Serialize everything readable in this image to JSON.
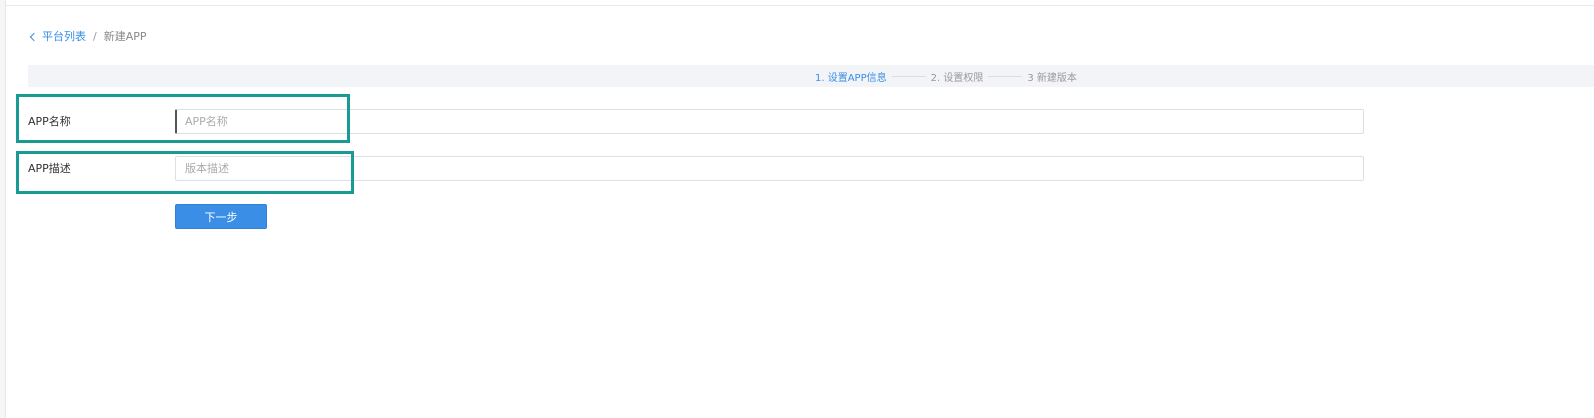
{
  "breadcrumb": {
    "back_label": "平台列表",
    "separator": "/",
    "current": "新建APP"
  },
  "steps": [
    {
      "label": "1. 设置APP信息",
      "active": true
    },
    {
      "label": "2. 设置权限",
      "active": false
    },
    {
      "label": "3 新建版本",
      "active": false
    }
  ],
  "form": {
    "app_name": {
      "label": "APP名称",
      "value": "",
      "placeholder": "APP名称"
    },
    "app_description": {
      "label": "APP描述",
      "value": "",
      "placeholder": "版本描述"
    }
  },
  "actions": {
    "next_label": "下一步"
  },
  "colors": {
    "accent": "#3a8ee6",
    "highlight_box": "#1a9a94",
    "steps_bar_background": "#f3f4f7"
  },
  "icons": {
    "back": "chevron-left-icon"
  }
}
